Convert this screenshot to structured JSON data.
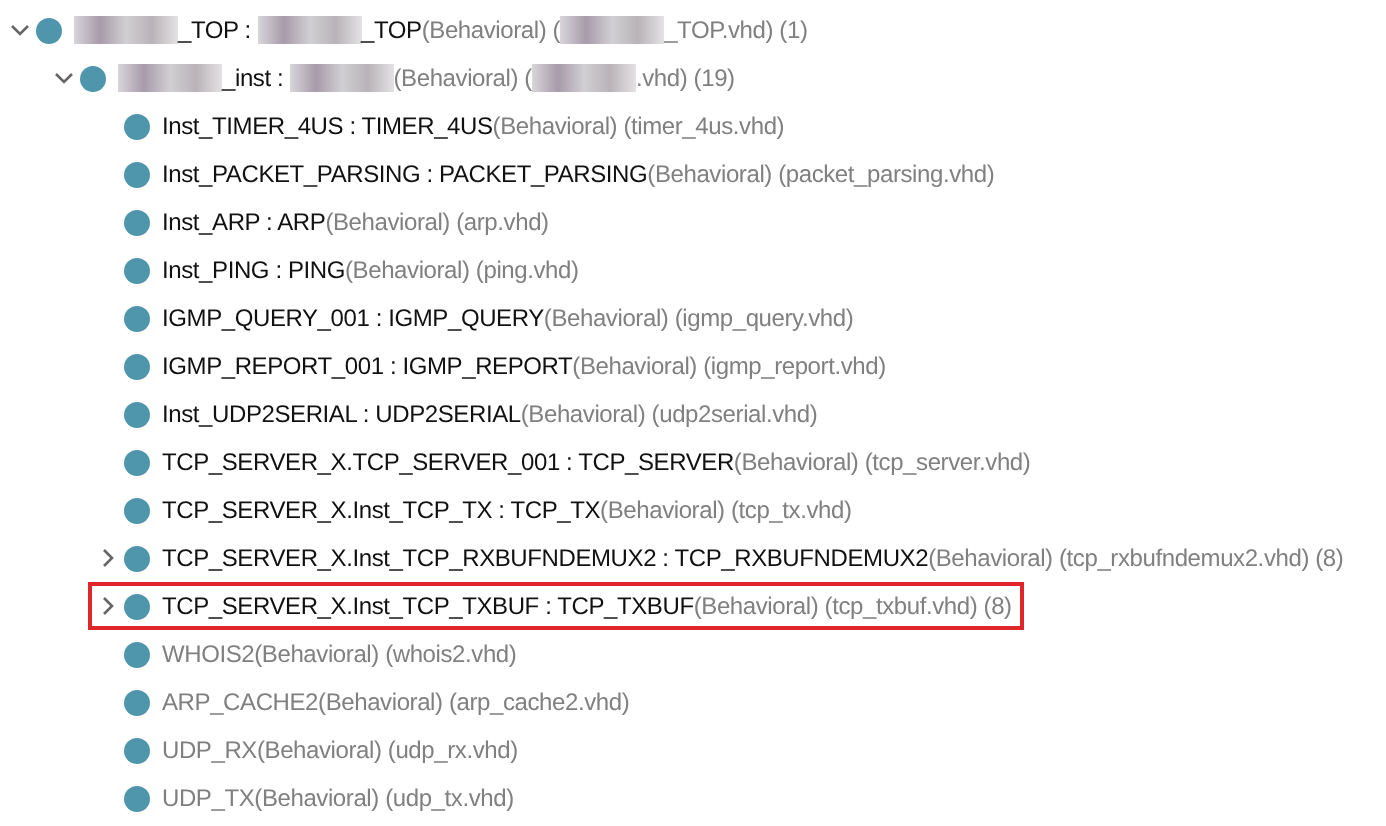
{
  "tree": [
    {
      "expanded": true,
      "segments": [
        {
          "kind": "redacted"
        },
        {
          "kind": "name",
          "text": "_TOP : "
        },
        {
          "kind": "redacted"
        },
        {
          "kind": "name",
          "text": "_TOP"
        },
        {
          "kind": "detail",
          "text": "(Behavioral) ("
        },
        {
          "kind": "redacted"
        },
        {
          "kind": "detail",
          "text": "_TOP.vhd) (1)"
        }
      ],
      "children": [
        {
          "expanded": true,
          "segments": [
            {
              "kind": "redacted"
            },
            {
              "kind": "name",
              "text": "_inst : "
            },
            {
              "kind": "redacted"
            },
            {
              "kind": "detail",
              "text": "(Behavioral) ("
            },
            {
              "kind": "redacted"
            },
            {
              "kind": "detail",
              "text": ".vhd) (19)"
            }
          ],
          "children": [
            {
              "highlighted": false,
              "segments": [
                {
                  "kind": "name",
                  "text": "Inst_TIMER_4US : TIMER_4US"
                },
                {
                  "kind": "detail",
                  "text": "(Behavioral) (timer_4us.vhd)"
                }
              ]
            },
            {
              "highlighted": false,
              "segments": [
                {
                  "kind": "name",
                  "text": "Inst_PACKET_PARSING : PACKET_PARSING"
                },
                {
                  "kind": "detail",
                  "text": "(Behavioral) (packet_parsing.vhd)"
                }
              ]
            },
            {
              "highlighted": false,
              "segments": [
                {
                  "kind": "name",
                  "text": "Inst_ARP : ARP"
                },
                {
                  "kind": "detail",
                  "text": "(Behavioral) (arp.vhd)"
                }
              ]
            },
            {
              "highlighted": false,
              "segments": [
                {
                  "kind": "name",
                  "text": "Inst_PING : PING"
                },
                {
                  "kind": "detail",
                  "text": "(Behavioral) (ping.vhd)"
                }
              ]
            },
            {
              "highlighted": false,
              "segments": [
                {
                  "kind": "name",
                  "text": "IGMP_QUERY_001 : IGMP_QUERY"
                },
                {
                  "kind": "detail",
                  "text": "(Behavioral) (igmp_query.vhd)"
                }
              ]
            },
            {
              "highlighted": false,
              "segments": [
                {
                  "kind": "name",
                  "text": "IGMP_REPORT_001 : IGMP_REPORT"
                },
                {
                  "kind": "detail",
                  "text": "(Behavioral) (igmp_report.vhd)"
                }
              ]
            },
            {
              "highlighted": false,
              "segments": [
                {
                  "kind": "name",
                  "text": "Inst_UDP2SERIAL : UDP2SERIAL"
                },
                {
                  "kind": "detail",
                  "text": "(Behavioral) (udp2serial.vhd)"
                }
              ]
            },
            {
              "highlighted": false,
              "segments": [
                {
                  "kind": "name",
                  "text": "TCP_SERVER_X.TCP_SERVER_001 : TCP_SERVER"
                },
                {
                  "kind": "detail",
                  "text": "(Behavioral) (tcp_server.vhd)"
                }
              ]
            },
            {
              "highlighted": false,
              "segments": [
                {
                  "kind": "name",
                  "text": "TCP_SERVER_X.Inst_TCP_TX : TCP_TX"
                },
                {
                  "kind": "detail",
                  "text": "(Behavioral) (tcp_tx.vhd)"
                }
              ]
            },
            {
              "highlighted": false,
              "expanded": false,
              "segments": [
                {
                  "kind": "name",
                  "text": "TCP_SERVER_X.Inst_TCP_RXBUFNDEMUX2 : TCP_RXBUFNDEMUX2"
                },
                {
                  "kind": "detail",
                  "text": "(Behavioral) (tcp_rxbufndemux2.vhd) (8)"
                }
              ]
            },
            {
              "highlighted": true,
              "expanded": false,
              "segments": [
                {
                  "kind": "name",
                  "text": "TCP_SERVER_X.Inst_TCP_TXBUF : TCP_TXBUF"
                },
                {
                  "kind": "detail",
                  "text": "(Behavioral) (tcp_txbuf.vhd) (8)"
                }
              ]
            },
            {
              "highlighted": false,
              "segments": [
                {
                  "kind": "detail",
                  "text": "WHOIS2(Behavioral) (whois2.vhd)"
                }
              ]
            },
            {
              "highlighted": false,
              "segments": [
                {
                  "kind": "detail",
                  "text": "ARP_CACHE2(Behavioral) (arp_cache2.vhd)"
                }
              ]
            },
            {
              "highlighted": false,
              "segments": [
                {
                  "kind": "detail",
                  "text": "UDP_RX(Behavioral) (udp_rx.vhd)"
                }
              ]
            },
            {
              "highlighted": false,
              "segments": [
                {
                  "kind": "detail",
                  "text": "UDP_TX(Behavioral) (udp_tx.vhd)"
                }
              ]
            }
          ]
        }
      ]
    }
  ]
}
